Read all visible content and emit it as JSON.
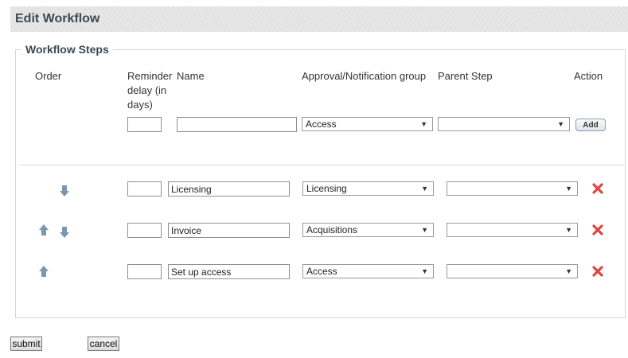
{
  "header": {
    "title": "Edit Workflow"
  },
  "section": {
    "legend": "Workflow Steps"
  },
  "columns": {
    "order": "Order",
    "reminder": "Reminder delay (in days)",
    "name": "Name",
    "group": "Approval/Notification group",
    "parent": "Parent Step",
    "action": "Action"
  },
  "new_step": {
    "reminder": "",
    "name": "",
    "group": "Access",
    "parent": "",
    "add_label": "Add"
  },
  "steps": [
    {
      "reminder": "",
      "name": "Licensing",
      "group": "Licensing",
      "parent": "",
      "move_up": false,
      "move_down": true
    },
    {
      "reminder": "",
      "name": "Invoice",
      "group": "Acquisitions",
      "parent": "",
      "move_up": true,
      "move_down": true
    },
    {
      "reminder": "",
      "name": "Set up access",
      "group": "Access",
      "parent": "",
      "move_up": true,
      "move_down": false
    }
  ],
  "icons": {
    "up": "arrow-up-icon",
    "down": "arrow-down-icon",
    "delete": "delete-x-icon"
  },
  "colors": {
    "header_bg": "#e2e2e2",
    "title_text": "#3c4a55",
    "arrow": "#7d95ad",
    "delete": "#e0443e"
  },
  "form": {
    "submit_label": "submit",
    "cancel_label": "cancel"
  }
}
